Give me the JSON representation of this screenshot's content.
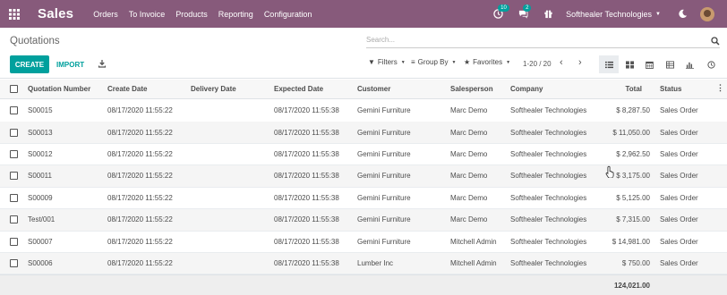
{
  "topbar": {
    "app_name": "Sales",
    "menu": [
      "Orders",
      "To Invoice",
      "Products",
      "Reporting",
      "Configuration"
    ],
    "activity_count": "10",
    "message_count": "2",
    "company": "Softhealer Technologies",
    "brand_color": "#875a7b"
  },
  "control_panel": {
    "title": "Quotations",
    "search_placeholder": "Search...",
    "create_label": "CREATE",
    "import_label": "IMPORT",
    "filters_label": "Filters",
    "group_by_label": "Group By",
    "favorites_label": "Favorites",
    "pager": "1-20 / 20",
    "prev_arrow": "‹",
    "next_arrow": "›",
    "accent_color": "#00a09d"
  },
  "table": {
    "columns": [
      "Quotation Number",
      "Create Date",
      "Delivery Date",
      "Expected Date",
      "Customer",
      "Salesperson",
      "Company",
      "Total",
      "Status"
    ],
    "rows": [
      {
        "number": "S00015",
        "create_date": "08/17/2020 11:55:22",
        "delivery_date": "",
        "expected_date": "08/17/2020 11:55:38",
        "customer": "Gemini Furniture",
        "salesperson": "Marc Demo",
        "company": "Softhealer Technologies",
        "total": "$ 8,287.50",
        "status": "Sales Order"
      },
      {
        "number": "S00013",
        "create_date": "08/17/2020 11:55:22",
        "delivery_date": "",
        "expected_date": "08/17/2020 11:55:38",
        "customer": "Gemini Furniture",
        "salesperson": "Marc Demo",
        "company": "Softhealer Technologies",
        "total": "$ 11,050.00",
        "status": "Sales Order"
      },
      {
        "number": "S00012",
        "create_date": "08/17/2020 11:55:22",
        "delivery_date": "",
        "expected_date": "08/17/2020 11:55:38",
        "customer": "Gemini Furniture",
        "salesperson": "Marc Demo",
        "company": "Softhealer Technologies",
        "total": "$ 2,962.50",
        "status": "Sales Order"
      },
      {
        "number": "S00011",
        "create_date": "08/17/2020 11:55:22",
        "delivery_date": "",
        "expected_date": "08/17/2020 11:55:38",
        "customer": "Gemini Furniture",
        "salesperson": "Marc Demo",
        "company": "Softhealer Technologies",
        "total": "$ 3,175.00",
        "status": "Sales Order"
      },
      {
        "number": "S00009",
        "create_date": "08/17/2020 11:55:22",
        "delivery_date": "",
        "expected_date": "08/17/2020 11:55:38",
        "customer": "Gemini Furniture",
        "salesperson": "Marc Demo",
        "company": "Softhealer Technologies",
        "total": "$ 5,125.00",
        "status": "Sales Order"
      },
      {
        "number": "Test/001",
        "create_date": "08/17/2020 11:55:22",
        "delivery_date": "",
        "expected_date": "08/17/2020 11:55:38",
        "customer": "Gemini Furniture",
        "salesperson": "Marc Demo",
        "company": "Softhealer Technologies",
        "total": "$ 7,315.00",
        "status": "Sales Order"
      },
      {
        "number": "S00007",
        "create_date": "08/17/2020 11:55:22",
        "delivery_date": "",
        "expected_date": "08/17/2020 11:55:38",
        "customer": "Gemini Furniture",
        "salesperson": "Mitchell Admin",
        "company": "Softhealer Technologies",
        "total": "$ 14,981.00",
        "status": "Sales Order"
      },
      {
        "number": "S00006",
        "create_date": "08/17/2020 11:55:22",
        "delivery_date": "",
        "expected_date": "08/17/2020 11:55:38",
        "customer": "Lumber Inc",
        "salesperson": "Mitchell Admin",
        "company": "Softhealer Technologies",
        "total": "$ 750.00",
        "status": "Sales Order"
      }
    ],
    "grand_total": "124,021.00"
  }
}
